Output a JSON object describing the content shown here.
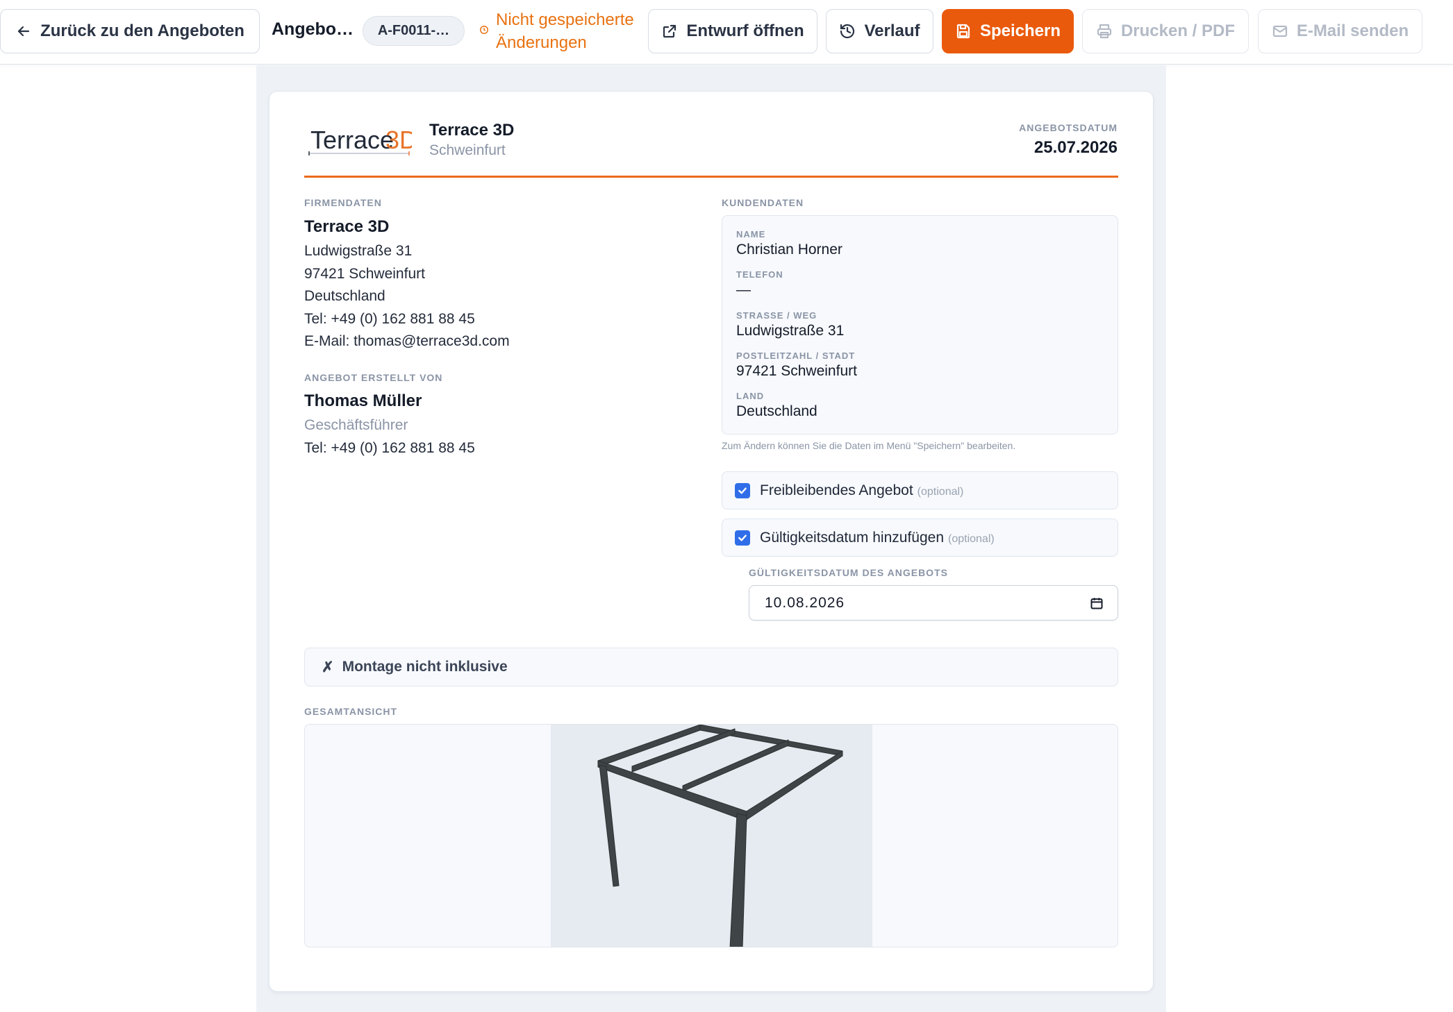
{
  "toolbar": {
    "back_label": "Zurück zu den Angeboten",
    "title": "Angebo…",
    "offer_id": "A-F0011-…",
    "unsaved_line1": "Nicht gespeicherte",
    "unsaved_line2": "Änderungen",
    "open_draft_label": "Entwurf öffnen",
    "history_label": "Verlauf",
    "save_label": "Speichern",
    "print_label": "Drucken / PDF",
    "email_label": "E-Mail senden",
    "accent_color": "#ea5a0c"
  },
  "header": {
    "logo_text_dark": "Terrace",
    "logo_text_accent": "3D",
    "company_name": "Terrace 3D",
    "company_city": "Schweinfurt",
    "date_label": "ANGEBOTSDATUM",
    "date_value": "25.07.2026"
  },
  "company": {
    "section_label": "FIRMENDATEN",
    "name": "Terrace 3D",
    "street": "Ludwigstraße 31",
    "city": "97421 Schweinfurt",
    "country": "Deutschland",
    "phone": "Tel: +49 (0) 162 881 88 45",
    "email": "E-Mail: thomas@terrace3d.com"
  },
  "creator": {
    "section_label": "ANGEBOT ERSTELLT VON",
    "name": "Thomas Müller",
    "role": "Geschäftsführer",
    "phone": "Tel: +49 (0) 162 881 88 45"
  },
  "customer": {
    "section_label": "KUNDENDATEN",
    "name_label": "NAME",
    "name": "Christian Horner",
    "phone_label": "TELEFON",
    "phone": "—",
    "street_label": "STRASSE / WEG",
    "street": "Ludwigstraße 31",
    "city_label": "POSTLEITZAHL / STADT",
    "city": "97421 Schweinfurt",
    "country_label": "LAND",
    "country": "Deutschland",
    "hint": "Zum Ändern können Sie die Daten im Menü \"Speichern\" bearbeiten."
  },
  "options": {
    "freibleibend_label": "Freibleibendes Angebot",
    "freibleibend_checked": true,
    "validity_label": "Gültigkeitsdatum hinzufügen",
    "validity_checked": true,
    "optional_tag": "(optional)",
    "validity_date_label": "GÜLTIGKEITSDATUM DES ANGEBOTS",
    "validity_date_value": "10.08.2026"
  },
  "montage": {
    "icon": "✗",
    "label": "Montage nicht inklusive"
  },
  "overview": {
    "section_label": "GESAMTANSICHT"
  }
}
